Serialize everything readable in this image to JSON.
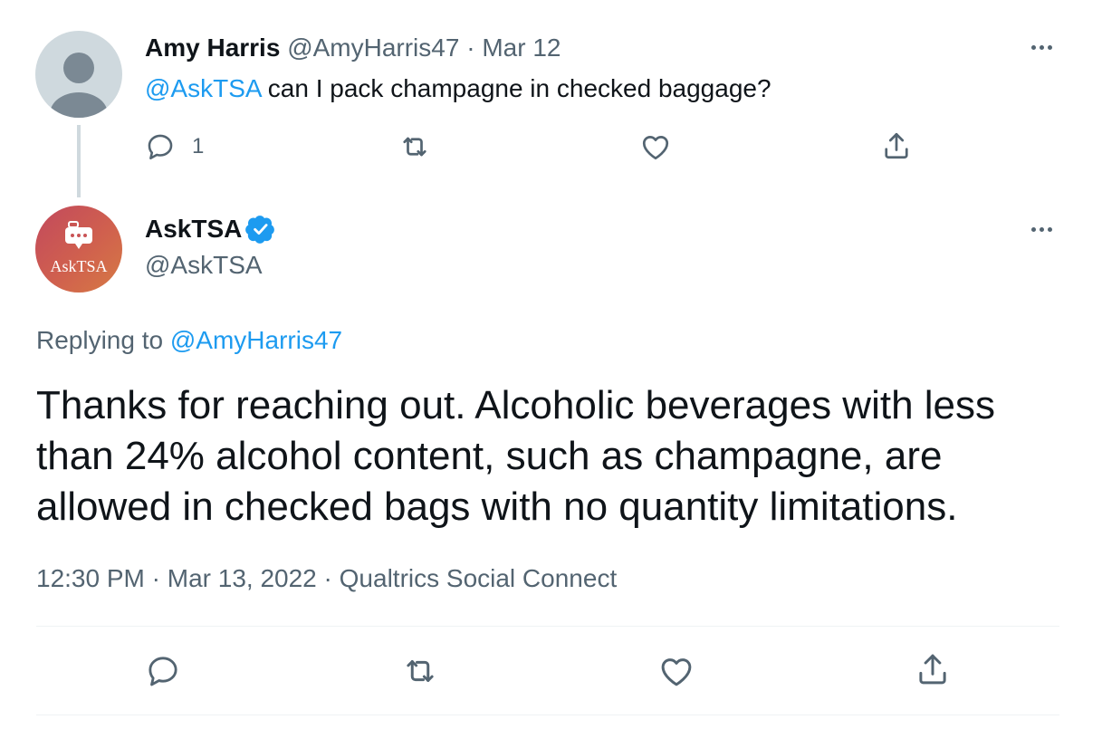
{
  "original_tweet": {
    "author_name": "Amy Harris",
    "handle": "@AmyHarris47",
    "separator": "·",
    "date": "Mar 12",
    "mention": "@AskTSA",
    "text": " can I pack champagne in checked baggage?",
    "reply_count": "1",
    "icons": [
      "reply-icon",
      "retweet-icon",
      "like-icon",
      "share-icon",
      "more-icon"
    ]
  },
  "reply_tweet": {
    "author_name": "AskTSA",
    "handle": "@AskTSA",
    "avatar_label": "AskTSA",
    "replying_prefix": "Replying to ",
    "replying_to": "@AmyHarris47",
    "text": "Thanks for reaching out. Alcoholic beverages with less than 24% alcohol content, such as champagne, are allowed in checked bags with no quantity limitations.",
    "time": "12:30 PM",
    "date": "Mar 13, 2022",
    "source": "Qualtrics Social Connect",
    "separator": "·",
    "icons": [
      "reply-icon",
      "retweet-icon",
      "like-icon",
      "share-icon",
      "verified-icon",
      "more-icon"
    ]
  },
  "colors": {
    "link": "#1d9bf0",
    "muted": "#536471",
    "text": "#0f1419",
    "divider": "#eff3f4",
    "avatar_gradient_start": "#c2495d",
    "avatar_gradient_end": "#d67a44"
  }
}
